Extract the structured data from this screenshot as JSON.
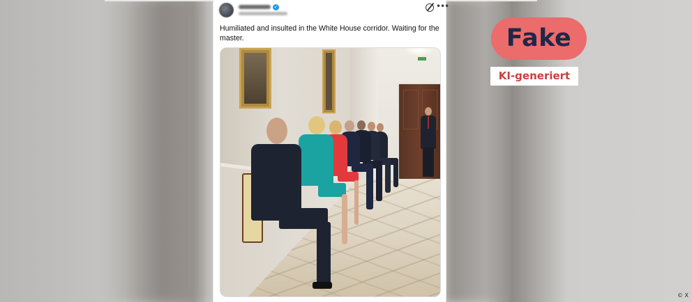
{
  "tweet": {
    "text": "Humiliated and insulted in the White House corridor. Waiting for the master.",
    "more_symbol": "•••",
    "verified_symbol": "✓"
  },
  "overlay": {
    "fake_label": "Fake",
    "ki_label": "KI-generiert",
    "copyright": "© X"
  },
  "colors": {
    "fake_badge_bg": "#ec6b6b",
    "fake_text": "#202748",
    "ki_text": "#c9403f",
    "verified_blue": "#1d9bf0"
  }
}
